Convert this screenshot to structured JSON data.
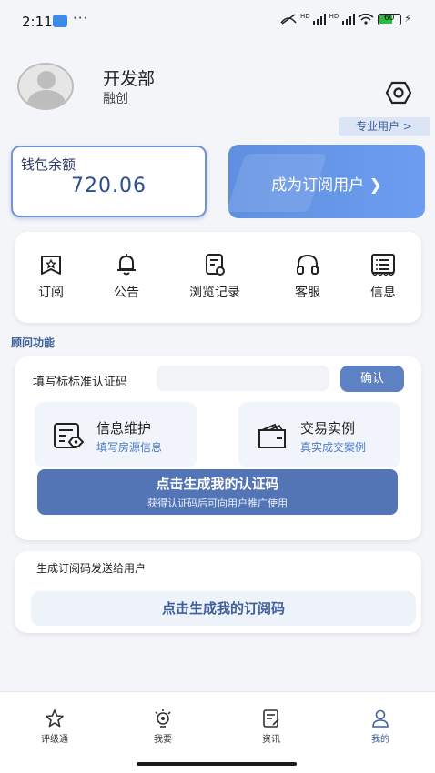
{
  "status_bar": {
    "time": "2:11",
    "more": "···",
    "battery_level": "60",
    "network_label": "HD"
  },
  "profile": {
    "name": "开发部",
    "company": "融创",
    "pro_tag": "专业用户 >"
  },
  "wallet": {
    "label": "钱包余额",
    "amount": "720.06"
  },
  "subscribe_banner": {
    "label": "成为订阅用户 ❯"
  },
  "quick_menu": [
    {
      "label": "订阅",
      "icon": "subscribe-icon"
    },
    {
      "label": "公告",
      "icon": "bell-icon"
    },
    {
      "label": "浏览记录",
      "icon": "history-icon"
    },
    {
      "label": "客服",
      "icon": "headset-icon"
    },
    {
      "label": "信息",
      "icon": "message-icon"
    }
  ],
  "advisor": {
    "section_title": "顾问功能",
    "cert_label": "填写标标准认证码",
    "cert_placeholder": "",
    "confirm_label": "确认",
    "features": [
      {
        "title": "信息维护",
        "subtitle": "填写房源信息",
        "icon": "info-edit-icon"
      },
      {
        "title": "交易实例",
        "subtitle": "真实成交案例",
        "icon": "wallet-icon"
      }
    ],
    "generate_cert_title": "点击生成我的认证码",
    "generate_cert_subtitle": "获得认证码后可向用户推广使用"
  },
  "subscription_code": {
    "label": "生成订阅码发送给用户",
    "button": "点击生成我的订阅码"
  },
  "bottom_nav": [
    {
      "label": "评级通",
      "icon": "star-icon",
      "active": false
    },
    {
      "label": "我要",
      "icon": "bulb-icon",
      "active": false
    },
    {
      "label": "资讯",
      "icon": "news-icon",
      "active": false
    },
    {
      "label": "我的",
      "icon": "person-icon",
      "active": true
    }
  ],
  "colors": {
    "accent": "#5475b5",
    "brand_blue": "#6c9df0",
    "background": "#f3f5f9"
  }
}
